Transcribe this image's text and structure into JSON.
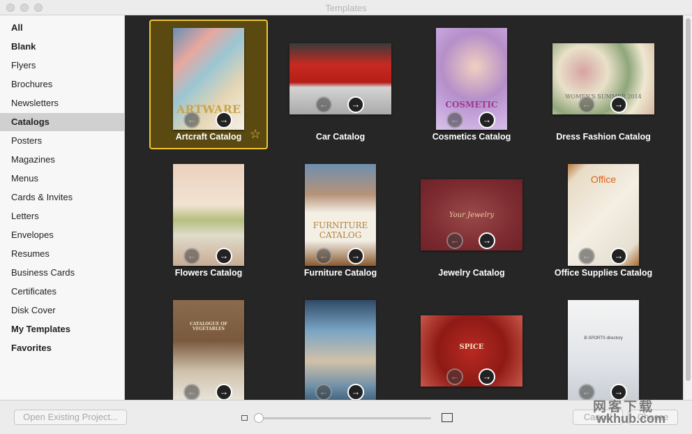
{
  "window": {
    "title": "Templates"
  },
  "sidebar": {
    "items": [
      {
        "label": "All",
        "bold": true
      },
      {
        "label": "Blank",
        "bold": true
      },
      {
        "label": "Flyers"
      },
      {
        "label": "Brochures"
      },
      {
        "label": "Newsletters"
      },
      {
        "label": "Catalogs",
        "bold": true,
        "selected": true
      },
      {
        "label": "Posters"
      },
      {
        "label": "Magazines"
      },
      {
        "label": "Menus"
      },
      {
        "label": "Cards & Invites"
      },
      {
        "label": "Letters"
      },
      {
        "label": "Envelopes"
      },
      {
        "label": "Resumes"
      },
      {
        "label": "Business Cards"
      },
      {
        "label": "Certificates"
      },
      {
        "label": "Disk Cover"
      },
      {
        "label": "My Templates",
        "bold": true
      },
      {
        "label": "Favorites",
        "bold": true
      }
    ]
  },
  "templates": [
    {
      "label": "Artcraft Catalog",
      "thumb_text": "ARTWARE",
      "selected": true,
      "favorite": true
    },
    {
      "label": "Car Catalog",
      "thumb_text": ""
    },
    {
      "label": "Cosmetics Catalog",
      "thumb_text": "COSMETIC"
    },
    {
      "label": "Dress Fashion Catalog",
      "thumb_text": "WOMEN'S SUMMER 2014"
    },
    {
      "label": "Flowers Catalog",
      "thumb_text": ""
    },
    {
      "label": "Furniture Catalog",
      "thumb_text": "FURNITURE CATALOG"
    },
    {
      "label": "Jewelry Catalog",
      "thumb_text": "Your Jewelry"
    },
    {
      "label": "Office Supplies Catalog",
      "thumb_text": "Office"
    },
    {
      "label": "",
      "thumb_text": "CATALOGUE OF VEGETABLES"
    },
    {
      "label": "",
      "thumb_text": ""
    },
    {
      "label": "",
      "thumb_text": "SPICE"
    },
    {
      "label": "",
      "thumb_text": "B-SPORTS directory"
    }
  ],
  "footer": {
    "open_existing": "Open Existing Project...",
    "cancel": "Cancel",
    "choose": "Choose",
    "zoom_value": 0
  },
  "watermark": {
    "line1": "网客下载",
    "line2": "wkhub.com"
  },
  "colors": {
    "accent": "#f2c530",
    "grid_bg": "#262626",
    "sidebar_selected": "#d0d0d0"
  }
}
